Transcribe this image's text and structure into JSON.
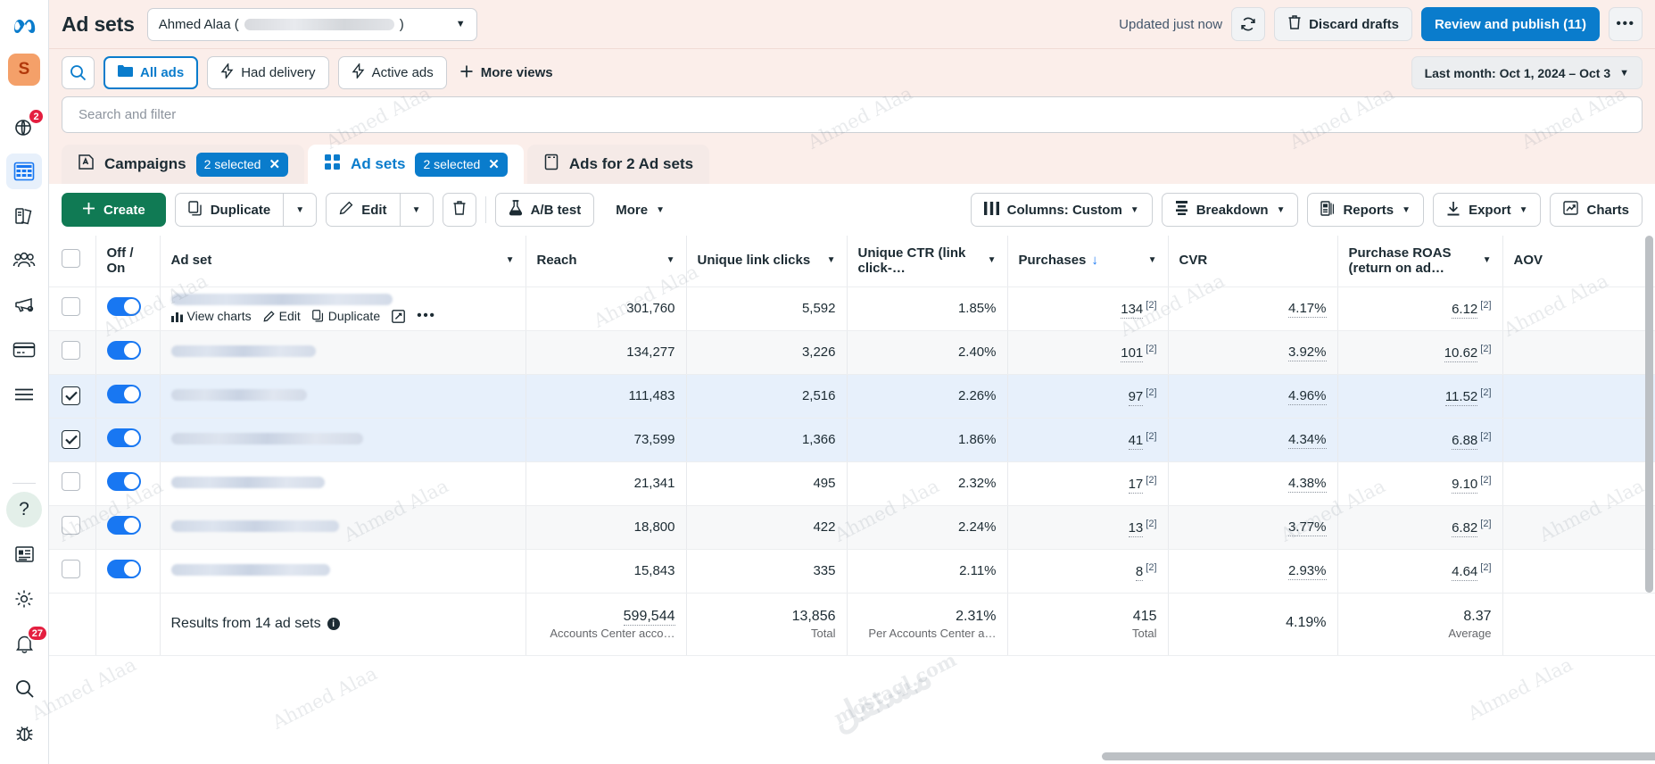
{
  "rail": {
    "logo": "meta-logo",
    "avatar_letter": "S",
    "items": [
      {
        "name": "notifications-globe-icon",
        "badge": "2"
      },
      {
        "name": "table-grid-icon",
        "badge": ""
      },
      {
        "name": "library-pages-icon",
        "badge": ""
      },
      {
        "name": "audiences-people-icon",
        "badge": ""
      },
      {
        "name": "megaphone-icon",
        "badge": ""
      },
      {
        "name": "billing-card-icon",
        "badge": ""
      },
      {
        "name": "all-tools-menu-icon",
        "badge": ""
      }
    ],
    "bottom_items": [
      {
        "name": "help-question-icon",
        "badge": ""
      },
      {
        "name": "news-article-icon",
        "badge": ""
      },
      {
        "name": "settings-gear-icon",
        "badge": ""
      },
      {
        "name": "notifications-bell-icon",
        "badge": "27"
      },
      {
        "name": "search-icon",
        "badge": ""
      },
      {
        "name": "bug-report-icon",
        "badge": ""
      }
    ]
  },
  "header": {
    "title": "Ad sets",
    "account_name": "Ahmed Alaa (",
    "account_name_suffix": ")",
    "updated_text": "Updated just now",
    "refresh_icon": "refresh-icon",
    "discard_label": "Discard drafts",
    "discard_icon": "trash-icon",
    "publish_label": "Review and publish (11)",
    "more_label": "•••"
  },
  "views": {
    "search_icon": "search-icon",
    "buttons": [
      {
        "label": "All ads",
        "icon": "folder-icon",
        "selected": true
      },
      {
        "label": "Had delivery",
        "icon": "bolt-icon",
        "selected": false
      },
      {
        "label": "Active ads",
        "icon": "bolt-icon",
        "selected": false
      }
    ],
    "more_views_label": "More views",
    "more_views_icon": "plus-icon",
    "date_range": "Last month: Oct 1, 2024 – Oct 3",
    "date_caret": "▼"
  },
  "search": {
    "placeholder": "Search and filter",
    "value": ""
  },
  "tabs": [
    {
      "label": "Campaigns",
      "icon": "campaign-icon",
      "chip": "2 selected",
      "active": false
    },
    {
      "label": "Ad sets",
      "icon": "adsets-icon",
      "chip": "2 selected",
      "active": true
    },
    {
      "label": "Ads for 2 Ad sets",
      "icon": "ads-icon",
      "chip": "",
      "active": false
    }
  ],
  "toolbar": {
    "create_label": "Create",
    "create_icon": "plus-icon",
    "duplicate_label": "Duplicate",
    "duplicate_icon": "copy-icon",
    "edit_label": "Edit",
    "edit_icon": "pencil-icon",
    "delete_icon": "trash-icon",
    "abtest_label": "A/B test",
    "abtest_icon": "flask-icon",
    "more_label": "More",
    "columns_label": "Columns: Custom",
    "columns_icon": "columns-icon",
    "breakdown_label": "Breakdown",
    "breakdown_icon": "breakdown-icon",
    "reports_label": "Reports",
    "reports_icon": "reports-icon",
    "export_label": "Export",
    "export_icon": "download-icon",
    "charts_label": "Charts",
    "charts_icon": "chart-icon",
    "caret": "▼"
  },
  "table": {
    "columns": [
      {
        "key": "checkbox",
        "label": "",
        "caret": false
      },
      {
        "key": "onoff",
        "label": "Off / On",
        "caret": false
      },
      {
        "key": "adset",
        "label": "Ad set",
        "caret": true
      },
      {
        "key": "reach",
        "label": "Reach",
        "caret": true
      },
      {
        "key": "unique_link_clicks",
        "label": "Unique link clicks",
        "caret": true
      },
      {
        "key": "unique_ctr",
        "label": "Unique CTR (link click-…",
        "caret": true
      },
      {
        "key": "purchases",
        "label": "Purchases",
        "caret": true,
        "sorted": true,
        "sort_icon": "↓"
      },
      {
        "key": "cvr",
        "label": "CVR",
        "caret": true
      },
      {
        "key": "purchase_roas",
        "label": "Purchase ROAS (return on ad…",
        "caret": true
      },
      {
        "key": "aov",
        "label": "AOV",
        "caret": false
      }
    ],
    "row_actions": [
      {
        "label": "View charts",
        "icon": "bar-chart-icon"
      },
      {
        "label": "Edit",
        "icon": "pencil-icon"
      },
      {
        "label": "Duplicate",
        "icon": "copy-icon"
      },
      {
        "label": "",
        "icon": "open-external-icon"
      },
      {
        "label": "•••",
        "icon": "more-icon"
      }
    ],
    "rows": [
      {
        "selected": false,
        "toggle": true,
        "name_hidden": true,
        "name_width": 240,
        "hovered": true,
        "reach": "301,760",
        "unique_link_clicks": "5,592",
        "unique_ctr": "1.85%",
        "purchases": "134",
        "purchases_sup": "[2]",
        "cvr": "4.17%",
        "purchase_roas": "6.12",
        "roas_sup": "[2]",
        "aov": ""
      },
      {
        "selected": false,
        "toggle": true,
        "name_hidden": true,
        "name_width": 160,
        "hovered": false,
        "reach": "134,277",
        "unique_link_clicks": "3,226",
        "unique_ctr": "2.40%",
        "purchases": "101",
        "purchases_sup": "[2]",
        "cvr": "3.92%",
        "purchase_roas": "10.62",
        "roas_sup": "[2]",
        "aov": ""
      },
      {
        "selected": true,
        "toggle": true,
        "name_hidden": true,
        "name_width": 150,
        "hovered": false,
        "reach": "111,483",
        "unique_link_clicks": "2,516",
        "unique_ctr": "2.26%",
        "purchases": "97",
        "purchases_sup": "[2]",
        "cvr": "4.96%",
        "purchase_roas": "11.52",
        "roas_sup": "[2]",
        "aov": ""
      },
      {
        "selected": true,
        "toggle": true,
        "name_hidden": true,
        "name_width": 210,
        "hovered": false,
        "reach": "73,599",
        "unique_link_clicks": "1,366",
        "unique_ctr": "1.86%",
        "purchases": "41",
        "purchases_sup": "[2]",
        "cvr": "4.34%",
        "purchase_roas": "6.88",
        "roas_sup": "[2]",
        "aov": ""
      },
      {
        "selected": false,
        "toggle": true,
        "name_hidden": true,
        "name_width": 170,
        "hovered": false,
        "reach": "21,341",
        "unique_link_clicks": "495",
        "unique_ctr": "2.32%",
        "purchases": "17",
        "purchases_sup": "[2]",
        "cvr": "4.38%",
        "purchase_roas": "9.10",
        "roas_sup": "[2]",
        "aov": ""
      },
      {
        "selected": false,
        "toggle": true,
        "name_hidden": true,
        "name_width": 185,
        "hovered": false,
        "reach": "18,800",
        "unique_link_clicks": "422",
        "unique_ctr": "2.24%",
        "purchases": "13",
        "purchases_sup": "[2]",
        "cvr": "3.77%",
        "purchase_roas": "6.82",
        "roas_sup": "[2]",
        "aov": ""
      },
      {
        "selected": false,
        "toggle": true,
        "name_hidden": true,
        "name_width": 175,
        "hovered": false,
        "reach": "15,843",
        "unique_link_clicks": "335",
        "unique_ctr": "2.11%",
        "purchases": "8",
        "purchases_sup": "[2]",
        "cvr": "2.93%",
        "purchase_roas": "4.64",
        "roas_sup": "[2]",
        "aov": ""
      }
    ],
    "summary": {
      "label": "Results from 14 ad sets",
      "info_icon": "info-icon",
      "reach": "599,544",
      "reach_sub": "Accounts Center acco…",
      "unique_link_clicks": "13,856",
      "unique_link_clicks_sub": "Total",
      "unique_ctr": "2.31%",
      "unique_ctr_sub": "Per Accounts Center a…",
      "purchases": "415",
      "purchases_sub": "Total",
      "cvr": "4.19%",
      "cvr_sub": "",
      "purchase_roas": "8.37",
      "purchase_roas_sub": "Average",
      "aov": "",
      "aov_sub": ""
    }
  },
  "watermark": {
    "tile": "Ahmed Alaa",
    "brand_ar": "مستقل",
    "brand_en": "mostaql.com"
  },
  "colors": {
    "accent_blue": "#0a7ccc",
    "create_green": "#107a54",
    "toggle_blue": "#1877f2",
    "badge_red": "#e41e3f",
    "header_bg": "#fbeeea",
    "selected_row": "#e7f0fb",
    "avatar_bg": "#f4a069"
  }
}
